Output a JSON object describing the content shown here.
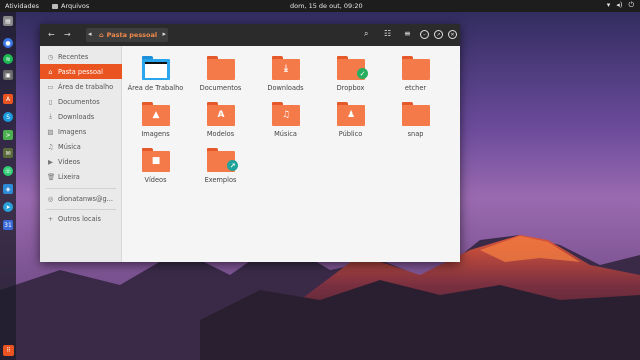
{
  "topbar": {
    "activities": "Atividades",
    "app_name": "Arquivos",
    "clock": "dom, 15 de out, 09:20",
    "tray_icons": [
      "wifi-icon",
      "volume-icon",
      "power-icon"
    ]
  },
  "dock": {
    "apps": [
      "files",
      "chromium",
      "spotify",
      "shotwell",
      "ubuntu-software",
      "shazam",
      "terminal",
      "evolution",
      "whatsapp",
      "remote",
      "telegram",
      "calendar"
    ],
    "show_apps_icon": "grid-icon"
  },
  "window": {
    "path": {
      "current": "Pasta pessoal",
      "icon": "home-icon"
    },
    "tools": [
      "search-icon",
      "view-list-icon",
      "menu-icon"
    ],
    "controls": [
      "minimize-icon",
      "maximize-icon",
      "close-icon"
    ]
  },
  "sidebar": {
    "items": [
      {
        "label": "Recentes",
        "icon": "clock-icon"
      },
      {
        "label": "Pasta pessoal",
        "icon": "home-icon",
        "active": true
      },
      {
        "label": "Área de trabalho",
        "icon": "desktop-icon"
      },
      {
        "label": "Documentos",
        "icon": "document-icon"
      },
      {
        "label": "Downloads",
        "icon": "download-icon"
      },
      {
        "label": "Imagens",
        "icon": "image-icon"
      },
      {
        "label": "Música",
        "icon": "music-icon"
      },
      {
        "label": "Vídeos",
        "icon": "video-icon"
      },
      {
        "label": "Lixeira",
        "icon": "trash-icon"
      }
    ],
    "account": {
      "label": "dionatanws@g...",
      "icon": "account-icon"
    },
    "other": {
      "label": "Outros locais",
      "icon": "plus-icon"
    }
  },
  "files": [
    {
      "label": "Área de Trabalho",
      "icon": "desktop-folder-icon"
    },
    {
      "label": "Documentos",
      "icon": "folder-icon"
    },
    {
      "label": "Downloads",
      "icon": "downloads-folder-icon"
    },
    {
      "label": "Dropbox",
      "icon": "dropbox-folder-icon"
    },
    {
      "label": "etcher",
      "icon": "folder-icon"
    },
    {
      "label": "Imagens",
      "icon": "pictures-folder-icon"
    },
    {
      "label": "Modelos",
      "icon": "templates-folder-icon"
    },
    {
      "label": "Música",
      "icon": "music-folder-icon"
    },
    {
      "label": "Público",
      "icon": "public-folder-icon"
    },
    {
      "label": "snap",
      "icon": "folder-icon"
    },
    {
      "label": "Vídeos",
      "icon": "videos-folder-icon"
    },
    {
      "label": "Exemplos",
      "icon": "examples-folder-icon"
    }
  ],
  "colors": {
    "accent": "#e95420",
    "folder": "#f57a4a",
    "header": "#2b2b2b"
  }
}
